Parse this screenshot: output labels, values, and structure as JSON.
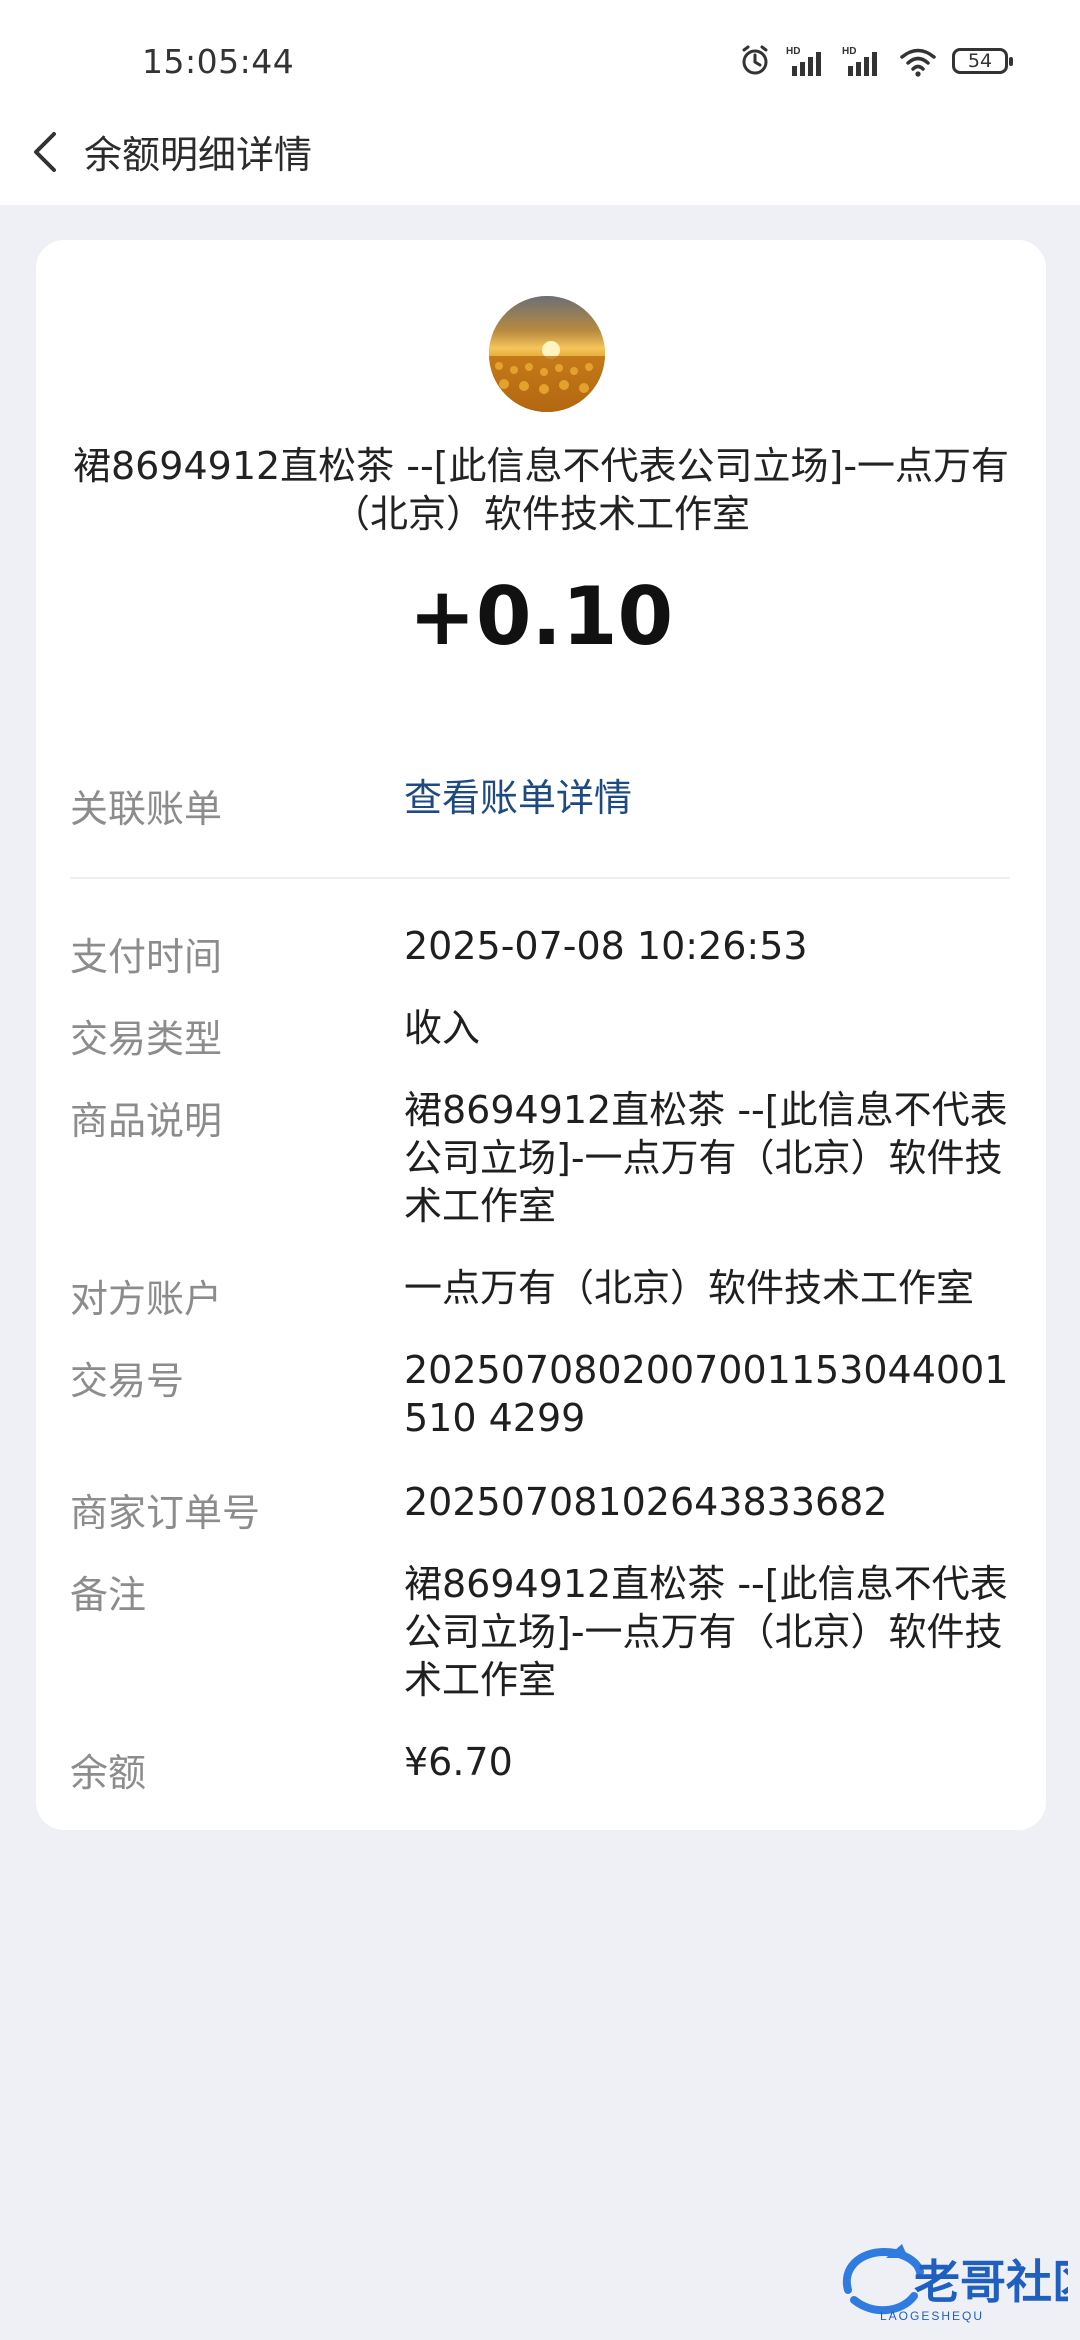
{
  "status_bar": {
    "time": "15:05:44",
    "battery": "54"
  },
  "header": {
    "title": "余额明细详情"
  },
  "summary": {
    "merchant_name": "裙8694912直松茶 --[此信息不代表公司立场]-一点万有（北京）软件技术工作室",
    "amount": "+0.10"
  },
  "details": {
    "linked_bill_label": "关联账单",
    "linked_bill_value": "查看账单详情",
    "pay_time_label": "支付时间",
    "pay_time_value": "2025-07-08 10:26:53",
    "trade_type_label": "交易类型",
    "trade_type_value": "收入",
    "product_label": "商品说明",
    "product_value": "裙8694912直松茶 --[此信息不代表公司立场]-一点万有（北京）软件技术工作室",
    "counterparty_label": "对方账户",
    "counterparty_value": "一点万有（北京）软件技术工作室",
    "trade_no_label": "交易号",
    "trade_no_value": "2025070802007001153044001510 4299",
    "merchant_order_label": "商家订单号",
    "merchant_order_value": "20250708102643833682",
    "remark_label": "备注",
    "remark_value": "裙8694912直松茶 --[此信息不代表公司立场]-一点万有（北京）软件技术工作室",
    "balance_label": "余额",
    "balance_value": "¥6.70"
  },
  "watermark": {
    "text": "老哥社区",
    "subtext": "LAOGESHEQU"
  }
}
